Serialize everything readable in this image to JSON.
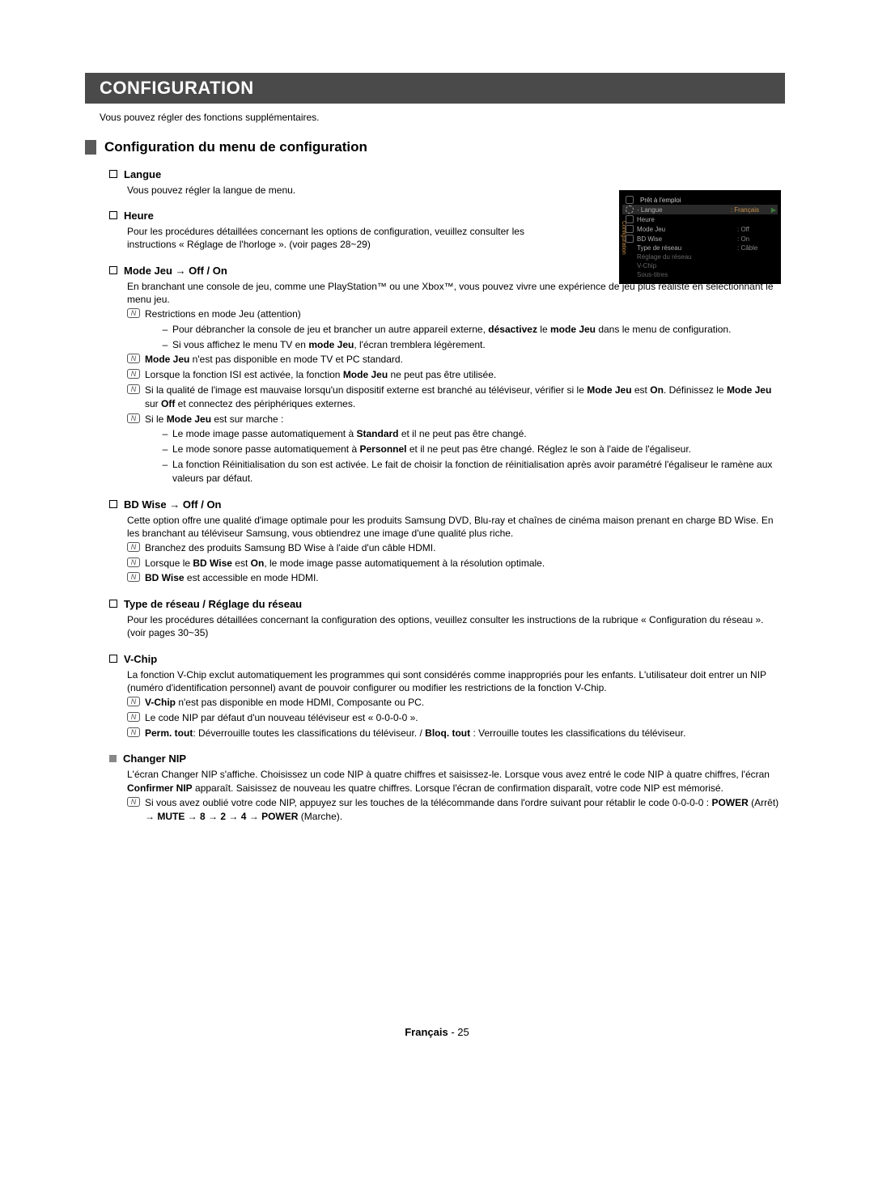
{
  "titleBar": "CONFIGURATION",
  "intro": "Vous pouvez régler des fonctions supplémentaires.",
  "subtitle": "Configuration du menu de configuration",
  "langue": {
    "head": "Langue",
    "body": "Vous pouvez régler la langue de menu."
  },
  "heure": {
    "head": "Heure",
    "body": "Pour les procédures détaillées concernant les options de configuration, veuillez consulter les instructions « Réglage de l'horloge ». (voir pages 28~29)"
  },
  "modeJeu": {
    "head": "Mode Jeu → Off / On",
    "body": "En branchant une console de jeu, comme une PlayStation™ ou une Xbox™, vous pouvez vivre une expérience de jeu plus réaliste en sélectionnant le menu jeu.",
    "n1": "Restrictions en mode Jeu (attention)",
    "d1a": "Pour débrancher la console de jeu et brancher un autre appareil externe, ",
    "d1b": "désactivez",
    "d1c": " le ",
    "d1d": "mode Jeu",
    "d1e": " dans le menu de configuration.",
    "d2a": "Si vous affichez le menu TV en ",
    "d2b": "mode Jeu",
    "d2c": ", l'écran tremblera légèrement.",
    "n2a": "Mode Jeu",
    "n2b": " n'est pas disponible en mode TV et PC standard.",
    "n3a": "Lorsque la fonction ISI est activée, la fonction ",
    "n3b": "Mode Jeu",
    "n3c": " ne peut pas être utilisée.",
    "n4a": "Si la qualité de l'image est mauvaise lorsqu'un dispositif externe est branché au téléviseur, vérifier si le ",
    "n4b": "Mode Jeu",
    "n4c": " est ",
    "n4d": "On",
    "n4e": ". Définissez le ",
    "n4f": "Mode Jeu",
    "n4g": " sur ",
    "n4h": "Off",
    "n4i": " et connectez des périphériques externes.",
    "n5a": "Si le ",
    "n5b": "Mode Jeu",
    "n5c": " est sur marche :",
    "d3a": "Le mode image passe automatiquement à ",
    "d3b": "Standard",
    "d3c": " et il ne peut pas être changé.",
    "d4a": "Le mode sonore passe automatiquement à ",
    "d4b": "Personnel",
    "d4c": " et il ne peut pas être changé. Réglez le son à l'aide de l'égaliseur.",
    "d5": "La fonction Réinitialisation du son est activée. Le fait de choisir la fonction de réinitialisation après avoir paramétré l'égaliseur le ramène aux valeurs par défaut."
  },
  "bdwise": {
    "head": "BD Wise → Off / On",
    "body": "Cette option offre une qualité d'image optimale pour les produits Samsung DVD, Blu-ray et chaînes de cinéma maison prenant en charge BD Wise. En les branchant au téléviseur Samsung, vous obtiendrez une image d'une qualité plus riche.",
    "n1": "Branchez des produits Samsung BD Wise à l'aide d'un câble HDMI.",
    "n2a": "Lorsque le ",
    "n2b": "BD Wise",
    "n2c": " est ",
    "n2d": "On",
    "n2e": ", le mode image passe automatiquement à la résolution optimale.",
    "n3a": "BD Wise",
    "n3b": " est accessible en mode HDMI."
  },
  "reseau": {
    "head": "Type de réseau / Réglage du réseau",
    "body": "Pour les procédures détaillées concernant la configuration des options, veuillez consulter les instructions de la rubrique « Configuration du réseau ». (voir pages 30~35)"
  },
  "vchip": {
    "head": "V-Chip",
    "body": "La fonction V-Chip exclut automatiquement les programmes qui sont considérés comme inappropriés pour les enfants. L'utilisateur doit entrer un NIP (numéro d'identification personnel) avant de pouvoir configurer ou modifier les restrictions de la fonction V-Chip.",
    "n1a": "V-Chip",
    "n1b": " n'est pas disponible en mode HDMI, Composante ou PC.",
    "n2": "Le code NIP par défaut d'un nouveau téléviseur est « 0-0-0-0 ».",
    "n3a": "Perm. tout",
    "n3b": ": Déverrouille toutes les classifications du téléviseur. / ",
    "n3c": "Bloq. tout",
    "n3d": " : Verrouille toutes les classifications du téléviseur."
  },
  "changer": {
    "head": "Changer NIP",
    "body1": "L'écran Changer NIP s'affiche. Choisissez un code NIP à quatre chiffres et saisissez-le. Lorsque vous avez entré le code NIP à quatre chiffres, l'écran ",
    "body2": "Confirmer NIP",
    "body3": " apparaît. Saisissez de nouveau les quatre chiffres. Lorsque l'écran de confirmation disparaît, votre code NIP est mémorisé.",
    "n1a": "Si vous avez oublié votre code NIP, appuyez sur les touches de la télécommande dans l'ordre suivant pour rétablir le code 0-0-0-0 : ",
    "n1b": "POWER",
    "n1c": " (Arrêt) → ",
    "n1d": "MUTE",
    "n1e": " → ",
    "n1f": "8",
    "n1g": " → ",
    "n1h": "2",
    "n1i": " → ",
    "n1j": "4",
    "n1k": " → ",
    "n1l": "POWER",
    "n1m": " (Marche)."
  },
  "osd": {
    "top": "Prêt à l'emploi",
    "side": "Configuration",
    "row_lang_label": "Langue",
    "row_lang_val": ": Français",
    "row_heure": "Heure",
    "row_mode_label": "Mode Jeu",
    "row_mode_val": ": Off",
    "row_bd_label": "BD Wise",
    "row_bd_val": ": On",
    "row_net_label": "Type de réseau",
    "row_net_val": ": Câble",
    "row_regl": "Réglage du réseau",
    "row_vchip": "V-Chip",
    "row_sous": "Sous-titres"
  },
  "footer": {
    "lang": "Français",
    "sep": " - ",
    "page": "25"
  }
}
